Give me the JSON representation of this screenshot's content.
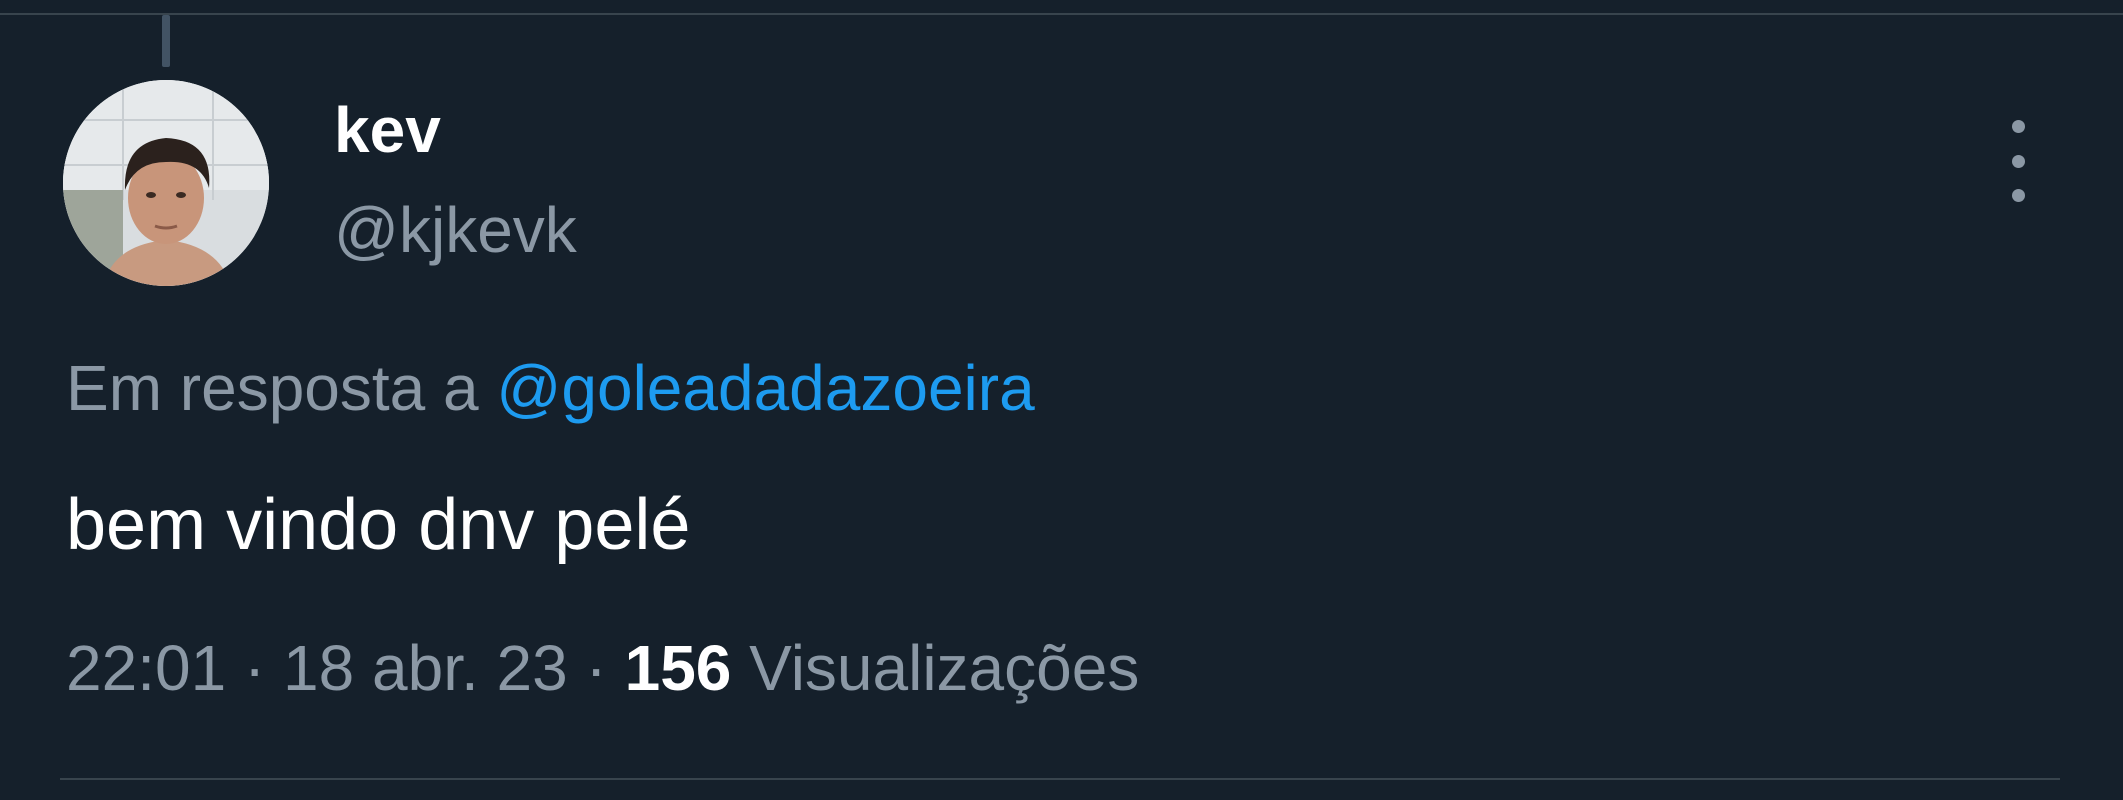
{
  "tweet": {
    "author": {
      "display_name": "kev",
      "handle": "@kjkevk"
    },
    "reply": {
      "prefix": "Em resposta a",
      "mention": "@goleadadazoeira"
    },
    "text": "bem vindo dnv pelé",
    "meta": {
      "time": "22:01",
      "separator": "·",
      "date": "18 abr. 23",
      "views_count": "156",
      "views_label": "Visualizações"
    },
    "icons": {
      "more": "more-vertical-icon"
    }
  },
  "colors": {
    "background": "#15202b",
    "primary_text": "#ffffff",
    "secondary_text": "#8b98a5",
    "link": "#1d9bf0",
    "divider": "#38444d"
  }
}
